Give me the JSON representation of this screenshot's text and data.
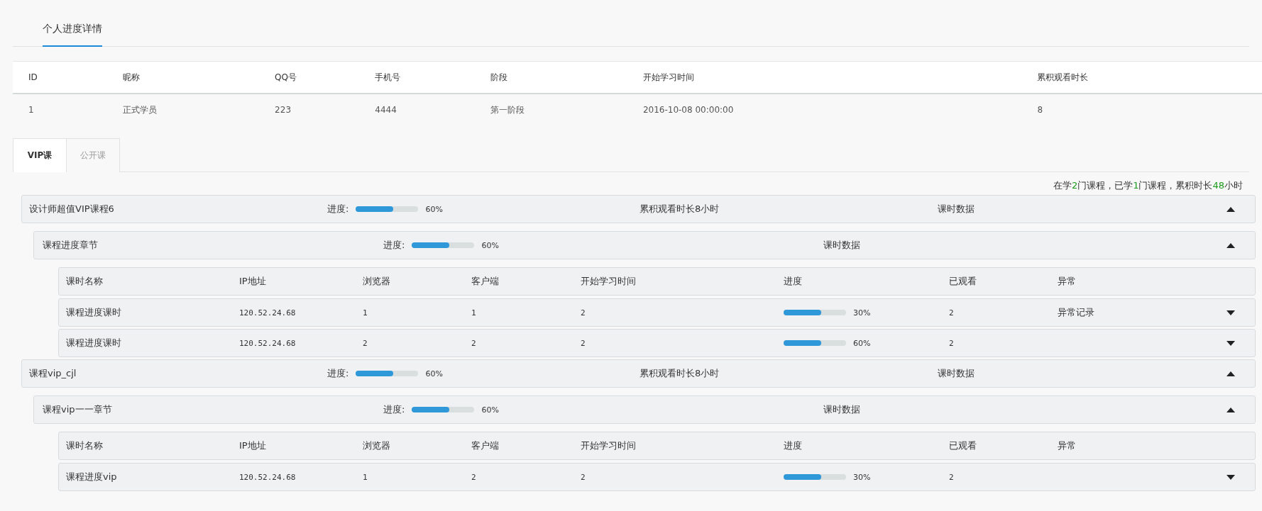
{
  "page_tab": {
    "label": "个人进度详情",
    "selected": true
  },
  "student_table": {
    "columns": [
      "ID",
      "昵称",
      "QQ号",
      "手机号",
      "阶段",
      "开始学习时间",
      "累积观看时长"
    ],
    "rows": [
      [
        "1",
        "正式学员",
        "223",
        "4444",
        "第一阶段",
        "2016-10-08 00:00:00",
        "8"
      ]
    ]
  },
  "course_tabs": [
    {
      "label": "VIP课",
      "selected": true
    },
    {
      "label": "公开课",
      "selected": false
    }
  ],
  "summary": [
    {
      "text": "在学",
      "kind": "plain"
    },
    {
      "text": "2",
      "kind": "count"
    },
    {
      "text": "门课程，已学",
      "kind": "plain"
    },
    {
      "text": "1",
      "kind": "count"
    },
    {
      "text": "门课程，累积时长",
      "kind": "plain"
    },
    {
      "text": "48",
      "kind": "count"
    },
    {
      "text": "小时",
      "kind": "plain"
    }
  ],
  "courses": [
    {
      "name": "设计师超值VIP课程6",
      "progress_label": "进度:",
      "level": 0.6,
      "percent": "60%",
      "watch_time": "累积观看时长8小时",
      "lesson_data_label": "课时数据",
      "expanded": true,
      "chapters": [
        {
          "name": "课程进度章节",
          "progress_label": "进度:",
          "level": 0.6,
          "percent": "60%",
          "lesson_data_label": "课时数据",
          "expanded": true,
          "lesson_columns": [
            "课时名称",
            "IP地址",
            "浏览器",
            "客户端",
            "开始学习时间",
            "进度",
            "已观看",
            "异常"
          ],
          "lessons": [
            {
              "name": "课程进度课时",
              "ip": "120.52.24.68",
              "browser": "1",
              "client": "1",
              "start": "2",
              "level": 0.6,
              "percent": "30%",
              "watched": "2",
              "abnormal": "异常记录",
              "expanded": false
            },
            {
              "name": "课程进度课时",
              "ip": "120.52.24.68",
              "browser": "2",
              "client": "2",
              "start": "2",
              "level": 0.6,
              "percent": "60%",
              "watched": "2",
              "expanded": false
            }
          ]
        }
      ]
    },
    {
      "name": "课程vip_cjl",
      "progress_label": "进度:",
      "level": 0.6,
      "percent": "60%",
      "watch_time": "累积观看时长8小时",
      "lesson_data_label": "课时数据",
      "expanded": true,
      "chapters": [
        {
          "name": "课程vip一一章节",
          "progress_label": "进度:",
          "level": 0.6,
          "percent": "60%",
          "lesson_data_label": "课时数据",
          "expanded": true,
          "lesson_columns": [
            "课时名称",
            "IP地址",
            "浏览器",
            "客户端",
            "开始学习时间",
            "进度",
            "已观看",
            "异常"
          ],
          "lessons": [
            {
              "name": "课程进度vip",
              "ip": "120.52.24.68",
              "browser": "1",
              "client": "2",
              "start": "2",
              "level": 0.6,
              "percent": "30%",
              "watched": "2",
              "expanded": false
            }
          ]
        }
      ]
    }
  ]
}
